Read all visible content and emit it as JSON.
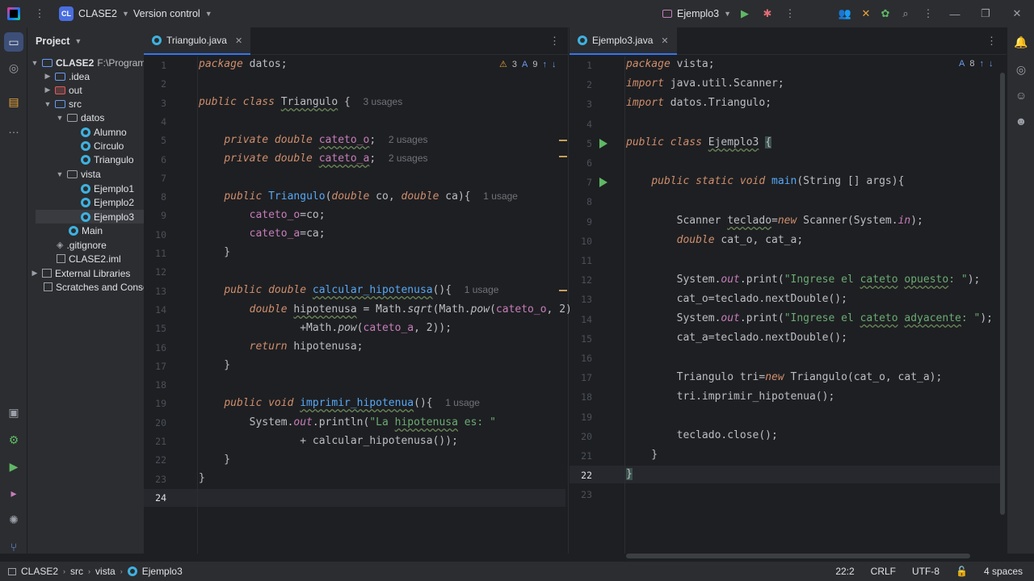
{
  "titlebar": {
    "project_badge": "CL",
    "project_name": "CLASE2",
    "vcs": "Version control",
    "run_config": "Ejemplo3"
  },
  "project_panel": {
    "title": "Project",
    "tree": [
      {
        "label": "CLASE2",
        "extra": "F:\\Program"
      },
      {
        "label": ".idea"
      },
      {
        "label": "out"
      },
      {
        "label": "src"
      },
      {
        "label": "datos"
      },
      {
        "label": "Alumno"
      },
      {
        "label": "Circulo"
      },
      {
        "label": "Triangulo"
      },
      {
        "label": "vista"
      },
      {
        "label": "Ejemplo1"
      },
      {
        "label": "Ejemplo2"
      },
      {
        "label": "Ejemplo3"
      },
      {
        "label": "Main"
      },
      {
        "label": ".gitignore"
      },
      {
        "label": "CLASE2.iml"
      },
      {
        "label": "External Libraries"
      },
      {
        "label": "Scratches and Conso"
      }
    ]
  },
  "left_editor": {
    "tab": "Triangulo.java",
    "warnings": "3",
    "weak": "9",
    "line_numbers": [
      "1",
      "2",
      "3",
      "4",
      "5",
      "6",
      "7",
      "8",
      "9",
      "10",
      "11",
      "12",
      "13",
      "14",
      "15",
      "16",
      "17",
      "18",
      "19",
      "20",
      "21",
      "22",
      "23",
      "24"
    ],
    "hints": {
      "class_usages": "3 usages",
      "field1_usages": "2 usages",
      "field2_usages": "2 usages",
      "ctor_usage": "1 usage",
      "calc_usage": "1 usage",
      "print_usage": "1 usage"
    }
  },
  "right_editor": {
    "tab": "Ejemplo3.java",
    "weak": "8",
    "line_numbers": [
      "1",
      "2",
      "3",
      "4",
      "5",
      "6",
      "7",
      "8",
      "9",
      "10",
      "11",
      "12",
      "13",
      "14",
      "15",
      "16",
      "17",
      "18",
      "19",
      "20",
      "21",
      "22",
      "23"
    ]
  },
  "statusbar": {
    "crumbs": [
      "CLASE2",
      "src",
      "vista",
      "Ejemplo3"
    ],
    "position": "22:2",
    "line_sep": "CRLF",
    "encoding": "UTF-8",
    "indent": "4 spaces"
  }
}
